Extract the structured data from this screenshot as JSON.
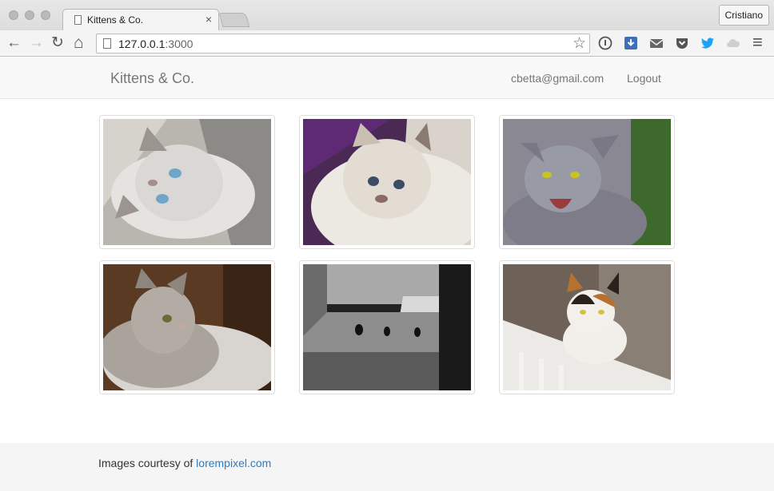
{
  "browser": {
    "tab_title": "Kittens & Co.",
    "tab_close": "×",
    "profile_name": "Cristiano",
    "url_host": "127.0.0.1",
    "url_port": ":3000",
    "icons": {
      "back": "←",
      "forward": "→",
      "reload": "↻",
      "home": "⌂",
      "star": "☆",
      "menu": "≡"
    }
  },
  "navbar": {
    "brand": "Kittens & Co.",
    "user_email": "cbetta@gmail.com",
    "logout": "Logout"
  },
  "gallery": {
    "images": [
      {
        "subject": "siamese-kitten-looking-up"
      },
      {
        "subject": "fluffy-white-cat"
      },
      {
        "subject": "hissing-grey-cat"
      },
      {
        "subject": "tabby-kitten-lying"
      },
      {
        "subject": "three-cats-in-street"
      },
      {
        "subject": "calico-cat-on-railing"
      }
    ]
  },
  "footer": {
    "credit_prefix": "Images courtesy of ",
    "credit_link": "lorempixel.com"
  },
  "colors": {
    "link": "#337ab7",
    "navbar_bg": "#f8f8f8",
    "navbar_text": "#777777",
    "footer_bg": "#f5f5f5"
  }
}
